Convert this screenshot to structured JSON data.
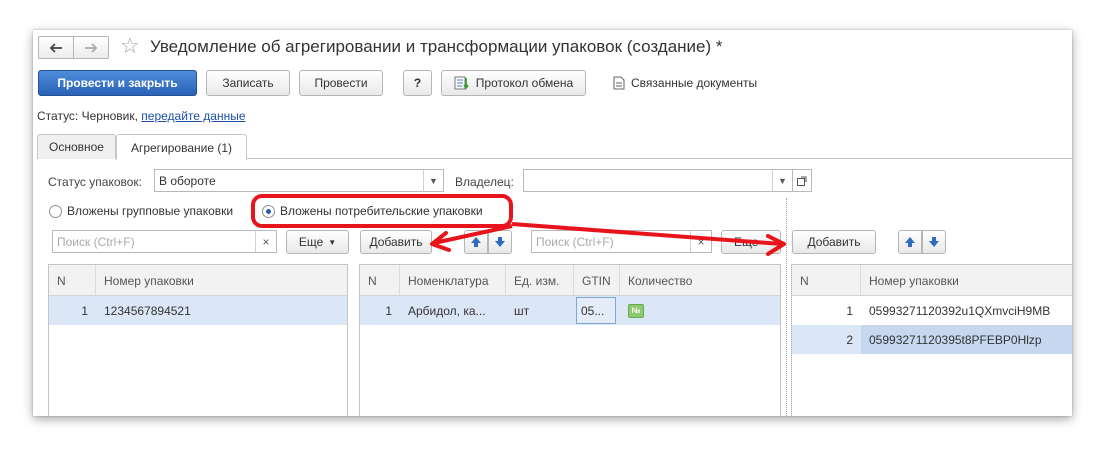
{
  "window": {
    "title": "Уведомление об агрегировании и трансформации упаковок (создание) *"
  },
  "toolbar": {
    "post_and_close": "Провести и закрыть",
    "save": "Записать",
    "post": "Провести",
    "help": "?",
    "exchange_log": "Протокол обмена",
    "related_docs": "Связанные документы"
  },
  "status": {
    "label": "Статус:",
    "value": "Черновик,",
    "link": "передайте данные"
  },
  "tabs": [
    {
      "label": "Основное"
    },
    {
      "label": "Агрегирование (1)"
    }
  ],
  "form": {
    "pack_status_label": "Статус упаковок:",
    "pack_status_value": "В обороте",
    "owner_label": "Владелец:",
    "owner_value": ""
  },
  "radio": {
    "group": "Вложены групповые упаковки",
    "consumer": "Вложены потребительские упаковки",
    "selected": "consumer"
  },
  "left_panel": {
    "search_placeholder": "Поиск (Ctrl+F)",
    "more": "Еще",
    "columns": [
      "N",
      "Номер упаковки"
    ],
    "rows": [
      {
        "n": "1",
        "number": "1234567894521"
      }
    ]
  },
  "middle_panel": {
    "add": "Добавить",
    "search_placeholder": "Поиск (Ctrl+F)",
    "more": "Еще",
    "columns": [
      "N",
      "Номенклатура",
      "Ед. изм.",
      "GTIN",
      "Количество"
    ],
    "rows": [
      {
        "n": "1",
        "item": "Арбидол, ка...",
        "unit": "шт",
        "gtin": "05...",
        "qty_icon": "№"
      }
    ]
  },
  "right_panel": {
    "add": "Добавить",
    "columns": [
      "N",
      "Номер упаковки"
    ],
    "rows": [
      {
        "n": "1",
        "number": "05993271120392u1QXmvciH9MB"
      },
      {
        "n": "2",
        "number": "05993271120395t8PFEBP0Hlzp"
      }
    ]
  },
  "colors": {
    "primary_button": "#2f6bbf",
    "annotation_red": "#e8141b",
    "selection": "#dbe6f6",
    "arrow_blue": "#2f6bbf"
  }
}
